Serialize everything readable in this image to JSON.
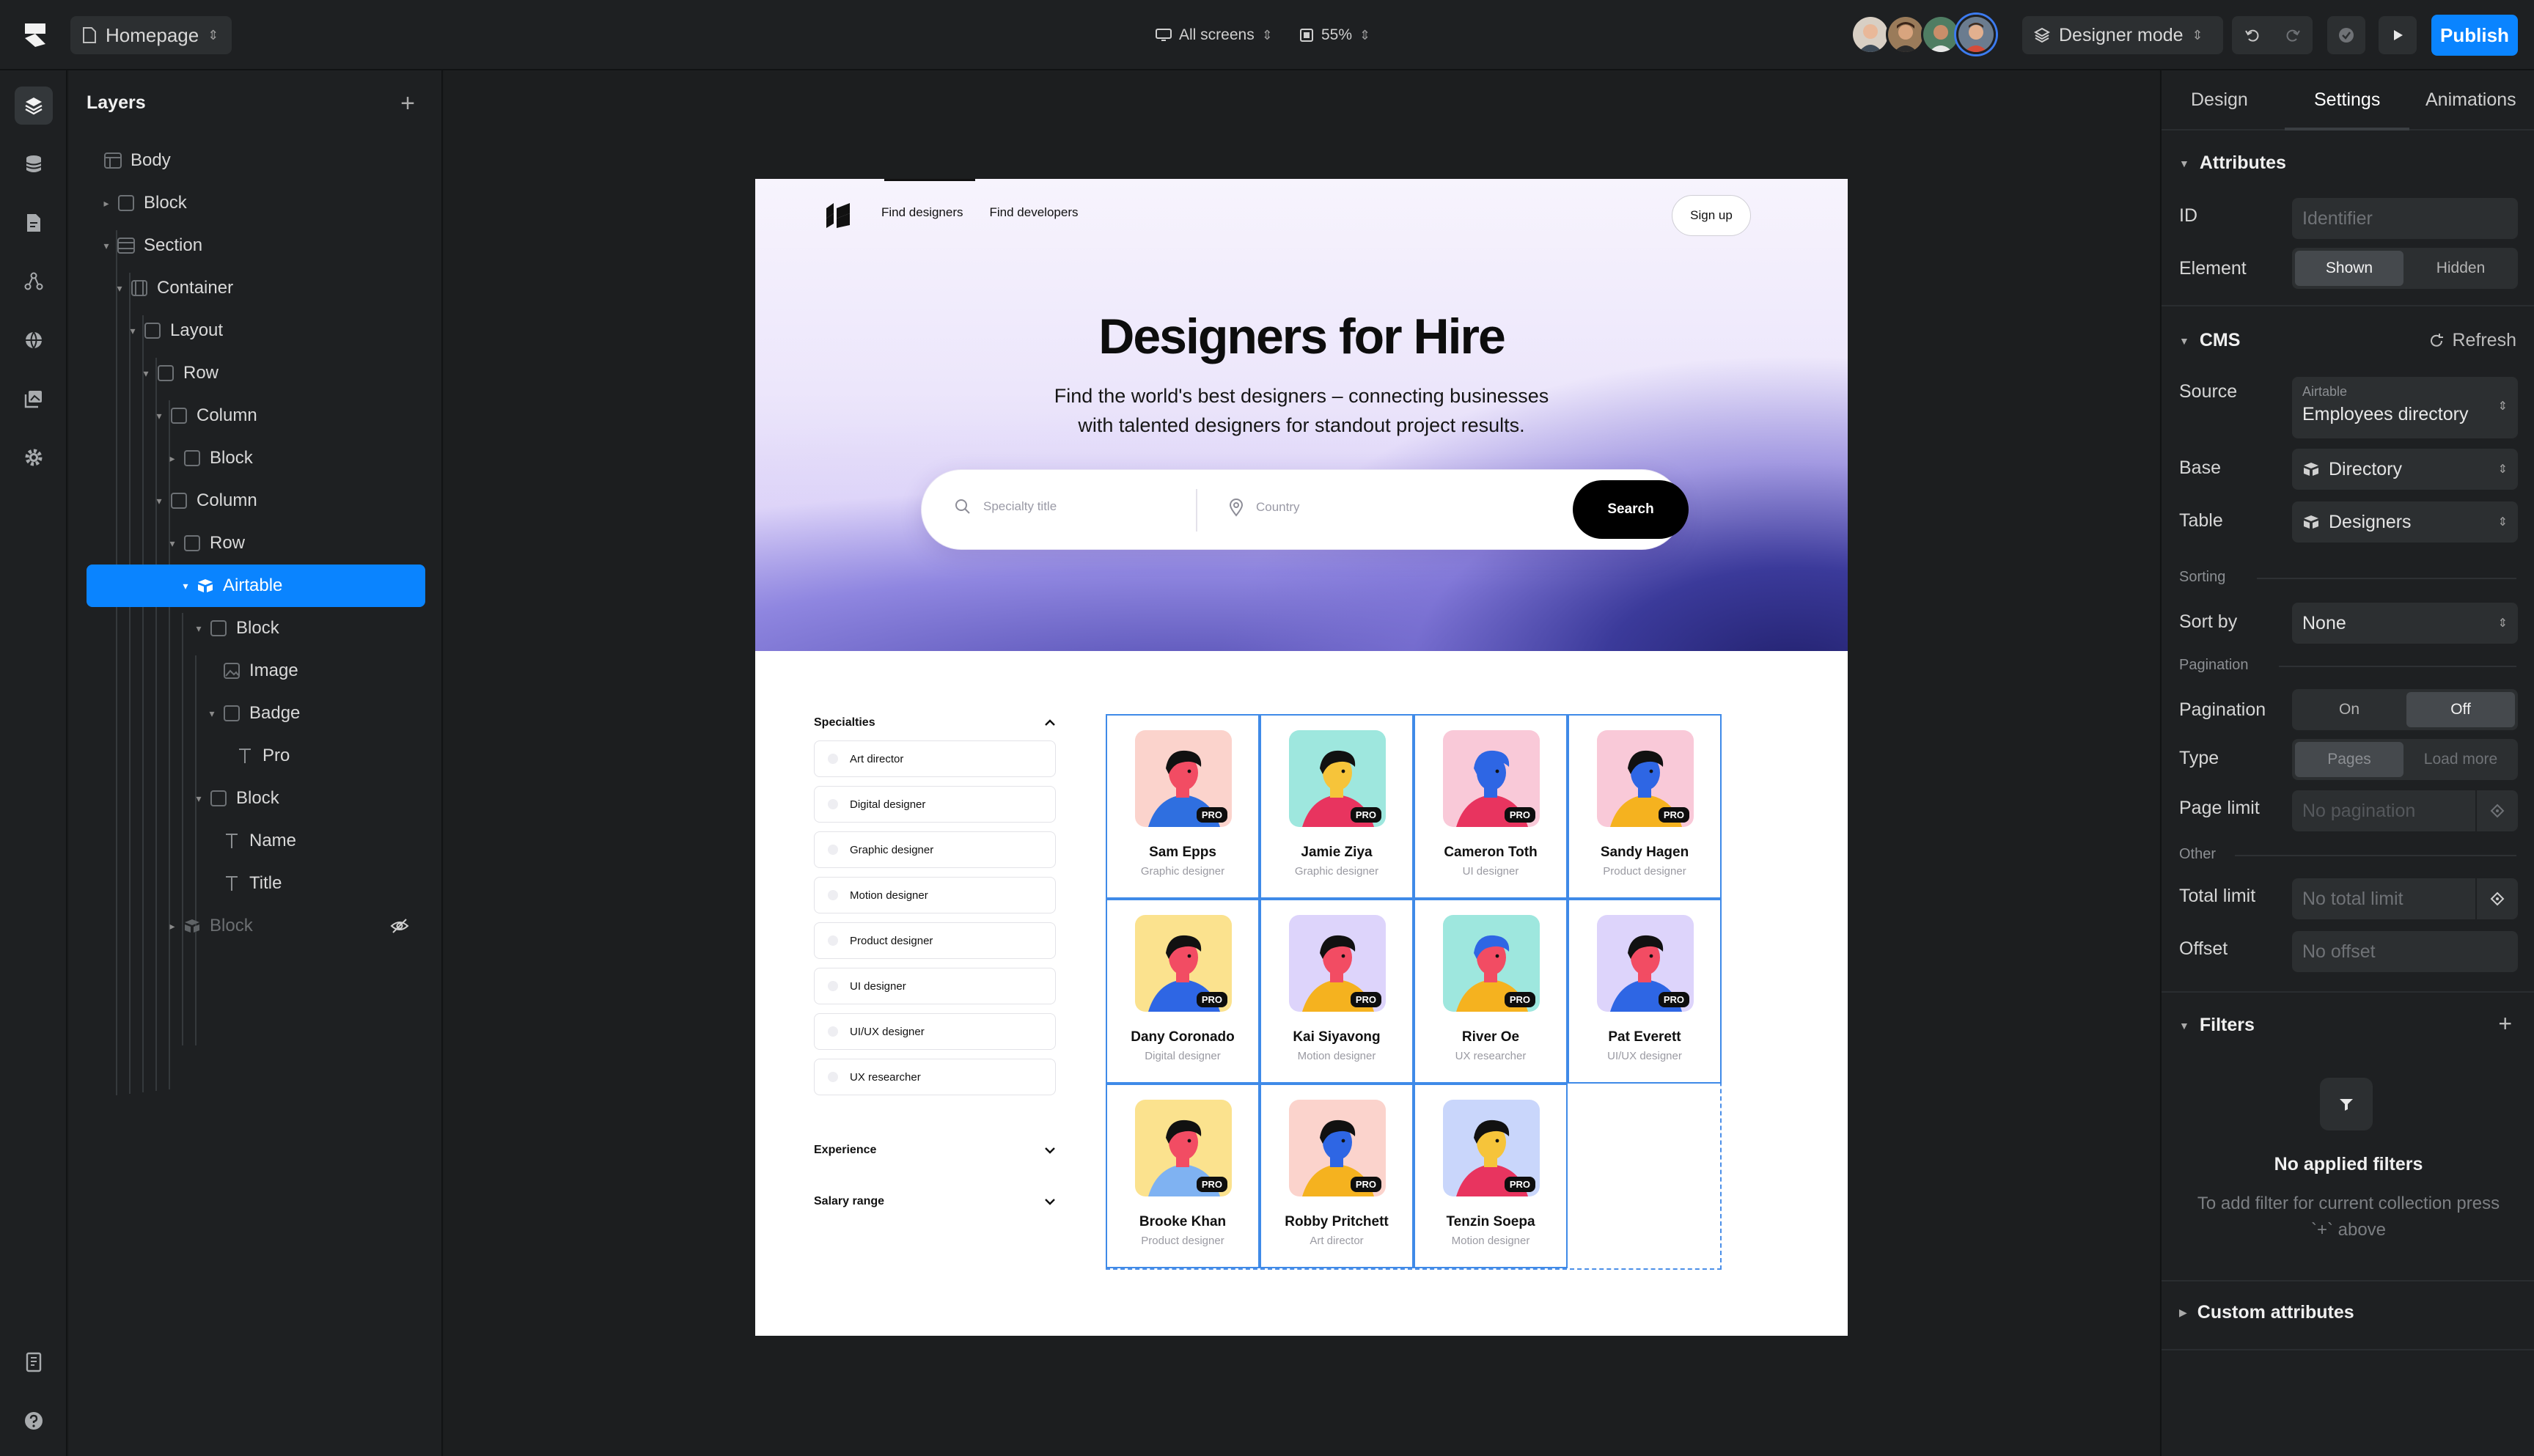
{
  "topbar": {
    "page": "Homepage",
    "screens": "All screens",
    "zoom": "55%",
    "mode": "Designer mode",
    "publish": "Publish"
  },
  "layers": {
    "title": "Layers",
    "add": "+",
    "items": [
      {
        "label": "Body"
      },
      {
        "label": "Block"
      },
      {
        "label": "Section"
      },
      {
        "label": "Container"
      },
      {
        "label": "Layout"
      },
      {
        "label": "Row"
      },
      {
        "label": "Column"
      },
      {
        "label": "Block"
      },
      {
        "label": "Column"
      },
      {
        "label": "Row"
      },
      {
        "label": "Airtable"
      },
      {
        "label": "Block"
      },
      {
        "label": "Image"
      },
      {
        "label": "Badge"
      },
      {
        "label": "Pro"
      },
      {
        "label": "Block"
      },
      {
        "label": "Name"
      },
      {
        "label": "Title"
      },
      {
        "label": "Block"
      }
    ]
  },
  "site": {
    "nav": [
      "Find designers",
      "Find developers"
    ],
    "signup": "Sign up",
    "title": "Designers for Hire",
    "subtitle_line1": "Find the world's best designers – connecting businesses",
    "subtitle_line2": "with talented designers for standout project results.",
    "search": {
      "specialty_placeholder": "Specialty title",
      "country_placeholder": "Country",
      "button": "Search"
    },
    "filters": {
      "specialties_label": "Specialties",
      "specialties": [
        "Art director",
        "Digital designer",
        "Graphic designer",
        "Motion designer",
        "Product designer",
        "UI designer",
        "UI/UX designer",
        "UX researcher"
      ],
      "experience_label": "Experience",
      "salary_label": "Salary range"
    },
    "badge": "PRO",
    "designers": [
      {
        "name": "Sam Epps",
        "role": "Graphic designer",
        "bg": "#fbd3cc",
        "skin": "#f24c63",
        "shirt": "#2f6fe0",
        "hair": "#111111"
      },
      {
        "name": "Jamie Ziya",
        "role": "Graphic designer",
        "bg": "#9ee7de",
        "skin": "#f6c43a",
        "shirt": "#e8345f",
        "hair": "#111111"
      },
      {
        "name": "Cameron Toth",
        "role": "UI designer",
        "bg": "#f9c9d8",
        "skin": "#2e66e4",
        "shirt": "#e8345f",
        "hair": "#2e66e4"
      },
      {
        "name": "Sandy Hagen",
        "role": "Product designer",
        "bg": "#f9c9d8",
        "skin": "#2e66e4",
        "shirt": "#f5b21f",
        "hair": "#111111"
      },
      {
        "name": "Dany Coronado",
        "role": "Digital designer",
        "bg": "#fbe28e",
        "skin": "#f24c63",
        "shirt": "#2e66e4",
        "hair": "#111111"
      },
      {
        "name": "Kai Siyavong",
        "role": "Motion designer",
        "bg": "#ddd4fb",
        "skin": "#f24c63",
        "shirt": "#f5b21f",
        "hair": "#111111"
      },
      {
        "name": "River Oe",
        "role": "UX researcher",
        "bg": "#9ee7de",
        "skin": "#f24c63",
        "shirt": "#f5b21f",
        "hair": "#2e66e4"
      },
      {
        "name": "Pat Everett",
        "role": "UI/UX designer",
        "bg": "#ddd4fb",
        "skin": "#f24c63",
        "shirt": "#2e66e4",
        "hair": "#111111"
      },
      {
        "name": "Brooke Khan",
        "role": "Product designer",
        "bg": "#fbe28e",
        "skin": "#f24c63",
        "shirt": "#7fb2f2",
        "hair": "#111111"
      },
      {
        "name": "Robby Pritchett",
        "role": "Art director",
        "bg": "#fbd3cc",
        "skin": "#2e66e4",
        "shirt": "#f5b21f",
        "hair": "#111111"
      },
      {
        "name": "Tenzin Soepa",
        "role": "Motion designer",
        "bg": "#c9d6fb",
        "skin": "#f6c43a",
        "shirt": "#e8345f",
        "hair": "#111111"
      }
    ]
  },
  "right_panel": {
    "tabs": [
      "Design",
      "Settings",
      "Animations"
    ],
    "attributes": {
      "title": "Attributes",
      "id_label": "ID",
      "id_placeholder": "Identifier",
      "element_label": "Element",
      "element_options": [
        "Shown",
        "Hidden"
      ]
    },
    "cms": {
      "title": "CMS",
      "refresh": "Refresh",
      "source_label": "Source",
      "source_provider": "Airtable",
      "source_value": "Employees directory",
      "base_label": "Base",
      "base_value": "Directory",
      "table_label": "Table",
      "table_value": "Designers",
      "sorting_group": "Sorting",
      "sortby_label": "Sort by",
      "sortby_value": "None",
      "pagination_group": "Pagination",
      "pagination_label": "Pagination",
      "pagination_options": [
        "On",
        "Off"
      ],
      "type_label": "Type",
      "type_options": [
        "Pages",
        "Load more"
      ],
      "pagelimit_label": "Page limit",
      "pagelimit_placeholder": "No pagination",
      "other_group": "Other",
      "totallimit_label": "Total limit",
      "totallimit_placeholder": "No total limit",
      "offset_label": "Offset",
      "offset_placeholder": "No offset"
    },
    "filters": {
      "title": "Filters",
      "empty_title": "No applied filters",
      "empty_desc": "To add filter for current collection press `+` above"
    },
    "custom": {
      "title": "Custom attributes"
    }
  },
  "colors": {
    "accent": "#0a84ff",
    "selection": "#3f8ae8"
  }
}
